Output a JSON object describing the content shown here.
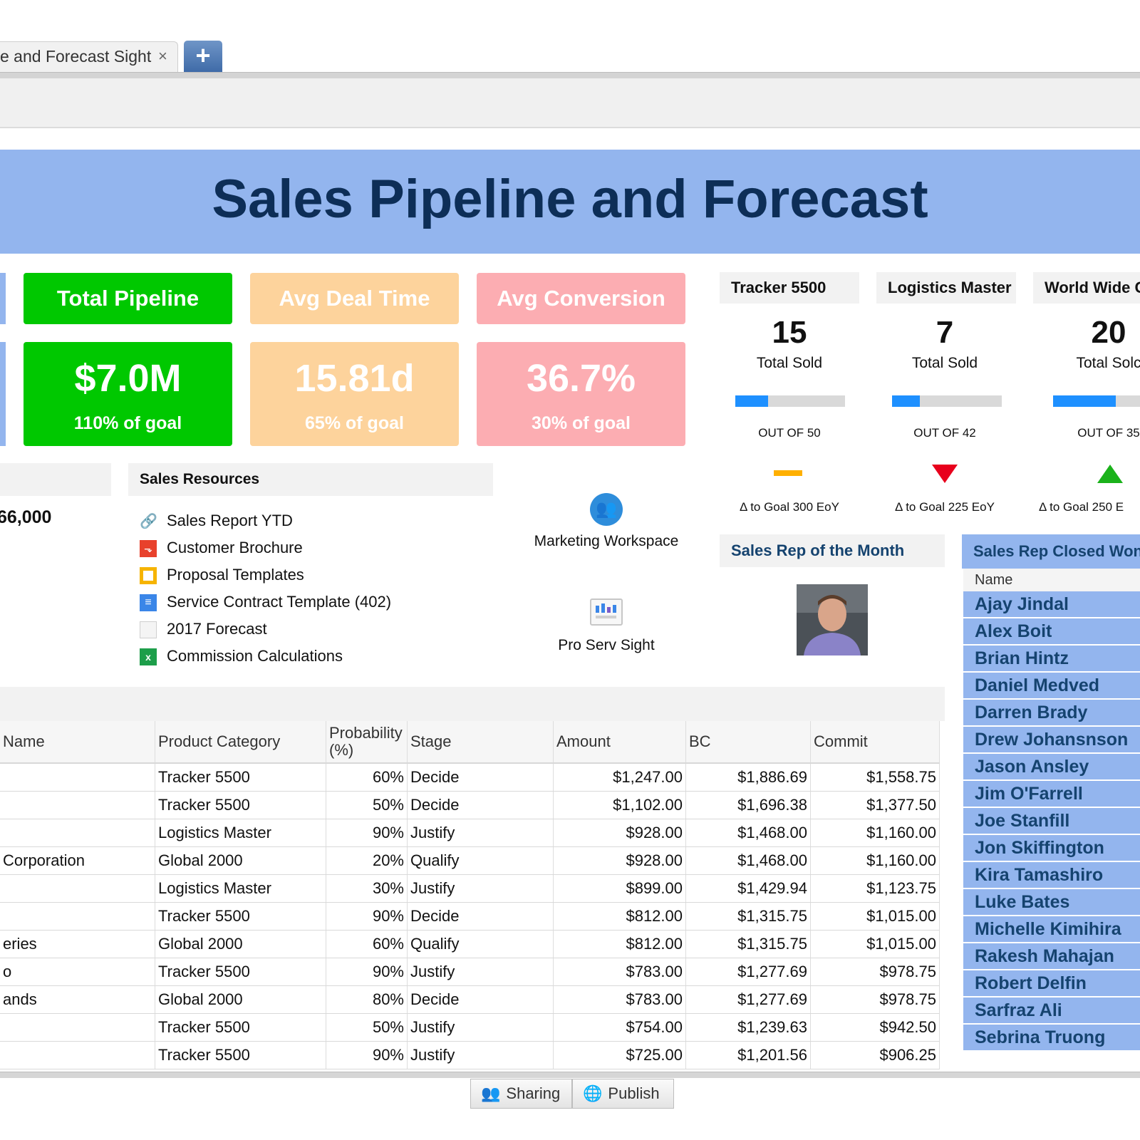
{
  "tabs": {
    "active_label": "e and Forecast Sight",
    "close_glyph": "×",
    "add_glyph": "+"
  },
  "banner": {
    "title": "Sales Pipeline and Forecast"
  },
  "kpis": [
    {
      "label": "Total Pipeline",
      "value": "$7.0M",
      "sub": "110% of goal",
      "color": "#00c800"
    },
    {
      "label": "Avg Deal Time",
      "value": "15.81d",
      "sub": "65% of goal",
      "color": "#fdd39c"
    },
    {
      "label": "Avg Conversion",
      "value": "36.7%",
      "sub": "30% of goal",
      "color": "#fcadb2"
    }
  ],
  "products": [
    {
      "name": "Tracker 5500",
      "count": "15",
      "count_label": "Total Sold",
      "out_of": "OUT OF 50",
      "progress": 0.3,
      "trend": "flat",
      "delta": "Δ to Goal 300 EoY"
    },
    {
      "name": "Logistics Master",
      "count": "7",
      "count_label": "Total Sold",
      "out_of": "OUT OF 42",
      "progress": 0.25,
      "trend": "down",
      "delta": "Δ to Goal 225 EoY"
    },
    {
      "name": "World Wide C",
      "count": "20",
      "count_label": "Total Solc",
      "out_of": "OUT OF 35",
      "progress": 0.57,
      "trend": "up",
      "delta": "Δ to Goal 250 E"
    }
  ],
  "left_panel": {
    "value": "66,000"
  },
  "resources": {
    "title": "Sales Resources",
    "items": [
      {
        "label": "Sales Report YTD",
        "icon": "link-icon"
      },
      {
        "label": "Customer Brochure",
        "icon": "pdf-icon"
      },
      {
        "label": "Proposal Templates",
        "icon": "slides-icon"
      },
      {
        "label": "Service Contract Template (402)",
        "icon": "doc-icon"
      },
      {
        "label": "2017 Forecast",
        "icon": "file-icon"
      },
      {
        "label": "Commission Calculations",
        "icon": "spreadsheet-icon"
      }
    ]
  },
  "apps": [
    {
      "label": "Marketing Workspace",
      "icon": "workspace-icon"
    },
    {
      "label": "Pro Serv Sight",
      "icon": "dashboard-icon"
    }
  ],
  "rep_of_month": {
    "title": "Sales Rep of the Month"
  },
  "closed_won": {
    "title": "Sales Rep Closed Won",
    "column": "Name",
    "names": [
      "Ajay Jindal",
      "Alex Boit",
      "Brian Hintz",
      "Daniel Medved",
      "Darren Brady",
      "Drew Johansnson",
      "Jason Ansley",
      "Jim O'Farrell",
      "Joe Stanfill",
      "Jon Skiffington",
      "Kira Tamashiro",
      "Luke Bates",
      "Michelle Kimihira",
      "Rakesh Mahajan",
      "Robert Delfin",
      "Sarfraz Ali",
      "Sebrina Truong"
    ]
  },
  "deals_table": {
    "headers": [
      "Name",
      "Product Category",
      "Probability (%)",
      "Stage",
      "Amount",
      "BC",
      "Commit"
    ],
    "rows": [
      [
        "",
        "Tracker 5500",
        "60%",
        "Decide",
        "$1,247.00",
        "$1,886.69",
        "$1,558.75"
      ],
      [
        "",
        "Tracker 5500",
        "50%",
        "Decide",
        "$1,102.00",
        "$1,696.38",
        "$1,377.50"
      ],
      [
        "",
        "Logistics Master",
        "90%",
        "Justify",
        "$928.00",
        "$1,468.00",
        "$1,160.00"
      ],
      [
        "Corporation",
        "Global 2000",
        "20%",
        "Qualify",
        "$928.00",
        "$1,468.00",
        "$1,160.00"
      ],
      [
        "",
        "Logistics Master",
        "30%",
        "Justify",
        "$899.00",
        "$1,429.94",
        "$1,123.75"
      ],
      [
        "",
        "Tracker 5500",
        "90%",
        "Decide",
        "$812.00",
        "$1,315.75",
        "$1,015.00"
      ],
      [
        "eries",
        "Global 2000",
        "60%",
        "Qualify",
        "$812.00",
        "$1,315.75",
        "$1,015.00"
      ],
      [
        "o",
        "Tracker 5500",
        "90%",
        "Justify",
        "$783.00",
        "$1,277.69",
        "$978.75"
      ],
      [
        "ands",
        "Global 2000",
        "80%",
        "Decide",
        "$783.00",
        "$1,277.69",
        "$978.75"
      ],
      [
        "",
        "Tracker 5500",
        "50%",
        "Justify",
        "$754.00",
        "$1,239.63",
        "$942.50"
      ],
      [
        "",
        "Tracker 5500",
        "90%",
        "Justify",
        "$725.00",
        "$1,201.56",
        "$906.25"
      ]
    ]
  },
  "footer": {
    "sharing_label": "Sharing",
    "publish_label": "Publish"
  }
}
